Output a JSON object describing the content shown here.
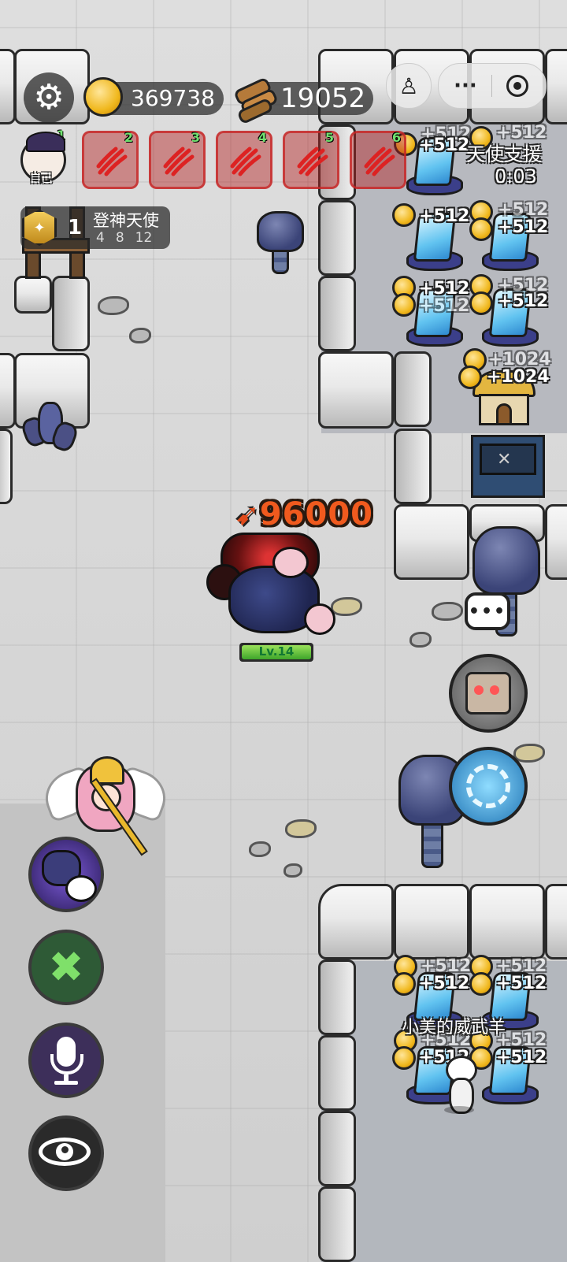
{
  "currency": {
    "gold": "369738",
    "wood": "19052"
  },
  "players": {
    "self_rank": "1",
    "self_label": "自己",
    "slots": [
      "2",
      "3",
      "4",
      "5",
      "6"
    ]
  },
  "title_badge": {
    "rank": "1",
    "name": "登神天使",
    "levels": [
      "4",
      "8",
      "12"
    ]
  },
  "angel_support": {
    "label": "天使支援",
    "timer": "0:03"
  },
  "boss": {
    "damage": "96000",
    "level": "Lv.14"
  },
  "income": {
    "small": "+512",
    "large": "+1024"
  },
  "npc": {
    "name": "小美的威武羊"
  },
  "icons": {
    "settings": "gear-icon",
    "gold": "coin-icon",
    "wood": "wood-logs-icon",
    "menu": "more-dots-icon",
    "close": "target-icon",
    "chat": "chat-bubble-icon",
    "robot": "robot-skill-icon",
    "blade": "blade-skill-icon",
    "wolf": "wolf-sheep-skill-icon",
    "build": "tools-icon",
    "mic": "microphone-icon",
    "eye": "eye-icon"
  }
}
